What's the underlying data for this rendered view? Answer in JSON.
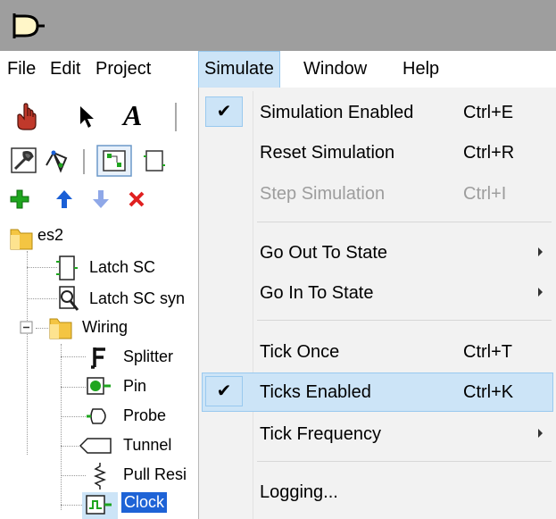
{
  "menubar": {
    "items": [
      {
        "label": "File"
      },
      {
        "label": "Edit"
      },
      {
        "label": "Project"
      },
      {
        "label": "Simulate"
      },
      {
        "label": "Window"
      },
      {
        "label": "Help"
      }
    ]
  },
  "toolbar": {
    "row1": [
      "hand-poke-icon",
      "select-arrow-icon",
      "text-tool-icon"
    ],
    "row2": [
      "edit-layout-icon",
      "circuit-tree-icon",
      "appearance-icon",
      "subcircuit-icon"
    ],
    "row3": [
      "add-circuit-icon",
      "move-up-icon",
      "move-down-icon",
      "delete-icon"
    ]
  },
  "tree": {
    "root": "es2",
    "items": [
      {
        "label": "Latch SC",
        "icon": "circuit-icon"
      },
      {
        "label": "Latch SC syn",
        "icon": "circuit-magnify-icon"
      },
      {
        "label": "Wiring",
        "icon": "folder-icon",
        "expanded": true
      },
      {
        "label": "Splitter",
        "icon": "splitter-icon"
      },
      {
        "label": "Pin",
        "icon": "pin-icon"
      },
      {
        "label": "Probe",
        "icon": "probe-icon"
      },
      {
        "label": "Tunnel",
        "icon": "tunnel-icon"
      },
      {
        "label": "Pull Resi",
        "icon": "pull-resistor-icon"
      },
      {
        "label": "Clock",
        "icon": "clock-icon",
        "selected": true
      }
    ]
  },
  "simulate_menu": {
    "items": [
      {
        "label": "Simulation Enabled",
        "shortcut": "Ctrl+E",
        "checked": true
      },
      {
        "label": "Reset Simulation",
        "shortcut": "Ctrl+R"
      },
      {
        "label": "Step Simulation",
        "shortcut": "Ctrl+I",
        "disabled": true
      },
      {
        "label": "Go Out To State",
        "submenu": true
      },
      {
        "label": "Go In To State",
        "submenu": true
      },
      {
        "label": "Tick Once",
        "shortcut": "Ctrl+T"
      },
      {
        "label": "Ticks Enabled",
        "shortcut": "Ctrl+K",
        "checked": true,
        "highlighted": true
      },
      {
        "label": "Tick Frequency",
        "submenu": true
      },
      {
        "label": "Logging..."
      }
    ],
    "check_glyph": "✔"
  },
  "colors": {
    "titlebar": "#9e9e9e",
    "menu_highlight": "#cce4f7",
    "menu_highlight_border": "#99c9ef",
    "menu_bg": "#f2f2f2",
    "disabled_text": "#9d9d9d",
    "folder": "#f4c542",
    "add_green": "#1fa51f",
    "arrow_blue": "#1a5fd6",
    "delete_red": "#e02020"
  }
}
